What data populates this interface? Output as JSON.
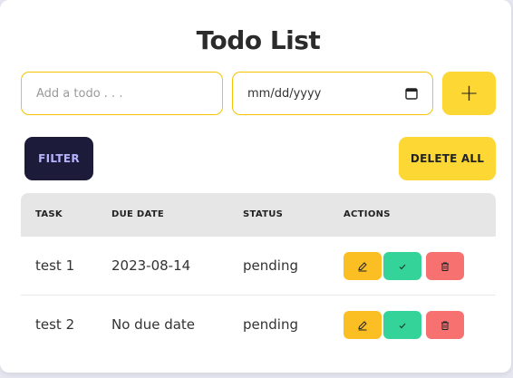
{
  "title": "Todo List",
  "todo_input": {
    "placeholder": "Add a todo . . ."
  },
  "date_input": {
    "placeholder": "mm/dd/yyyy"
  },
  "add_button": {
    "label": "+"
  },
  "filter_button": {
    "label": "FILTER"
  },
  "delete_all_button": {
    "label": "DELETE ALL"
  },
  "table": {
    "headers": [
      "TASK",
      "DUE DATE",
      "STATUS",
      "ACTIONS"
    ],
    "rows": [
      {
        "task": "test 1",
        "due_date": "2023-08-14",
        "status": "pending"
      },
      {
        "task": "test 2",
        "due_date": "No due date",
        "status": "pending"
      }
    ]
  },
  "icons": {
    "calendar": "calendar-icon",
    "edit": "pencil-icon",
    "complete": "check-icon",
    "delete": "trash-icon"
  },
  "colors": {
    "accent_yellow": "#fdd835",
    "filter_bg": "#1c1b3a",
    "filter_text": "#b6b3ff",
    "edit": "#fbbf24",
    "complete": "#34d399",
    "delete": "#f87171"
  }
}
